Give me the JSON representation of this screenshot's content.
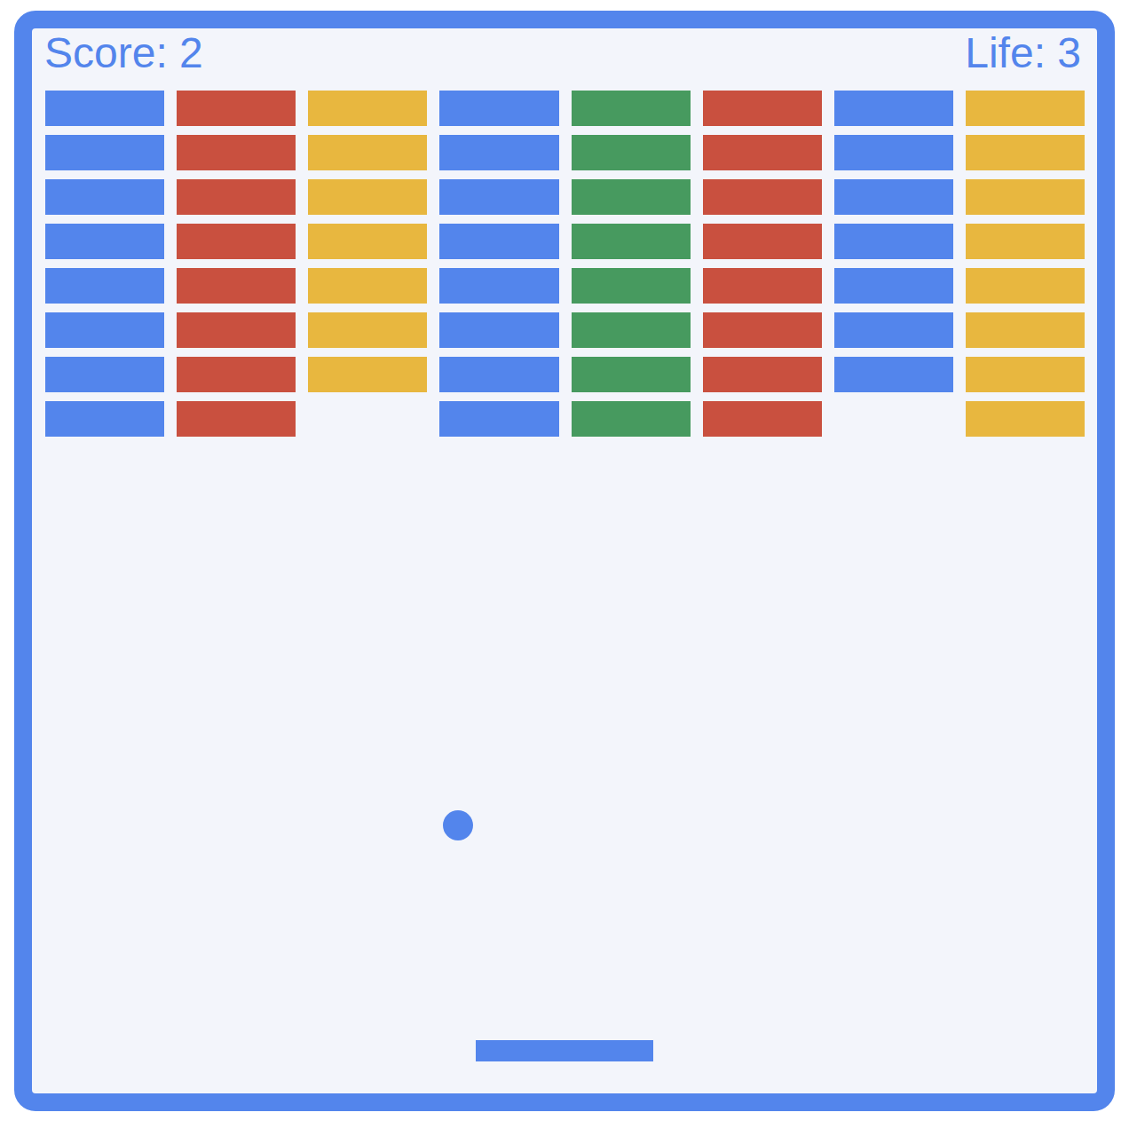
{
  "hud": {
    "score": "Score: 2",
    "life": "Life: 3"
  },
  "columns": [
    {
      "color": "#5385ec",
      "bricks": [
        {
          "intact": true
        },
        {
          "intact": true
        },
        {
          "intact": true
        },
        {
          "intact": true
        },
        {
          "intact": true
        },
        {
          "intact": true
        },
        {
          "intact": true
        },
        {
          "intact": true
        }
      ]
    },
    {
      "color": "#c9503f",
      "bricks": [
        {
          "intact": true
        },
        {
          "intact": true
        },
        {
          "intact": true
        },
        {
          "intact": true
        },
        {
          "intact": true
        },
        {
          "intact": true
        },
        {
          "intact": true
        },
        {
          "intact": true
        }
      ]
    },
    {
      "color": "#e8b73f",
      "bricks": [
        {
          "intact": true
        },
        {
          "intact": true
        },
        {
          "intact": true
        },
        {
          "intact": true
        },
        {
          "intact": true
        },
        {
          "intact": true
        },
        {
          "intact": true
        },
        {
          "intact": false
        }
      ]
    },
    {
      "color": "#5385ec",
      "bricks": [
        {
          "intact": true
        },
        {
          "intact": true
        },
        {
          "intact": true
        },
        {
          "intact": true
        },
        {
          "intact": true
        },
        {
          "intact": true
        },
        {
          "intact": true
        },
        {
          "intact": true
        }
      ]
    },
    {
      "color": "#479a5f",
      "bricks": [
        {
          "intact": true
        },
        {
          "intact": true
        },
        {
          "intact": true
        },
        {
          "intact": true
        },
        {
          "intact": true
        },
        {
          "intact": true
        },
        {
          "intact": true
        },
        {
          "intact": true
        }
      ]
    },
    {
      "color": "#c9503f",
      "bricks": [
        {
          "intact": true
        },
        {
          "intact": true
        },
        {
          "intact": true
        },
        {
          "intact": true
        },
        {
          "intact": true
        },
        {
          "intact": true
        },
        {
          "intact": true
        },
        {
          "intact": true
        }
      ]
    },
    {
      "color": "#5385ec",
      "bricks": [
        {
          "intact": true
        },
        {
          "intact": true
        },
        {
          "intact": true
        },
        {
          "intact": true
        },
        {
          "intact": true
        },
        {
          "intact": true
        },
        {
          "intact": true
        },
        {
          "intact": false
        }
      ]
    },
    {
      "color": "#e8b73f",
      "bricks": [
        {
          "intact": true
        },
        {
          "intact": true
        },
        {
          "intact": true
        },
        {
          "intact": true
        },
        {
          "intact": true
        },
        {
          "intact": true
        },
        {
          "intact": true
        },
        {
          "intact": true
        }
      ]
    }
  ]
}
